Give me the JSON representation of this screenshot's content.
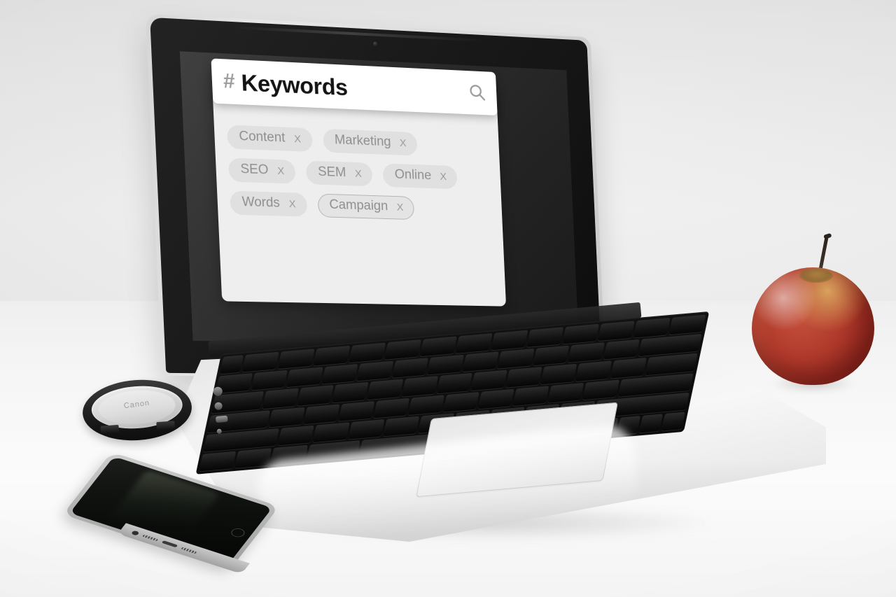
{
  "scene": {
    "title": "Keywords search app on laptop screen",
    "background_color": "#ebeaea",
    "desk_color": "#f7f7f7"
  },
  "screen": {
    "bezel_color": "#141414",
    "display_color": "#2a2a2a",
    "webcam_label": "webcam"
  },
  "app": {
    "panel_color": "#eeeeee",
    "search_bar": {
      "hash_symbol": "#",
      "title": "Keywords",
      "search_icon": "search-icon",
      "background_color": "#ffffff",
      "title_color": "#141414"
    },
    "tag_color": "#e0e0e0",
    "tag_text_color": "#8f8f8f",
    "remove_symbol": "X",
    "tag_rows": [
      [
        {
          "label": "Content",
          "remove": "X",
          "outlined": false
        },
        {
          "label": "Marketing",
          "remove": "X",
          "outlined": false
        }
      ],
      [
        {
          "label": "SEO",
          "remove": "X",
          "outlined": false
        },
        {
          "label": "SEM",
          "remove": "X",
          "outlined": false
        },
        {
          "label": "Online",
          "remove": "X",
          "outlined": false
        }
      ],
      [
        {
          "label": "Words",
          "remove": "X",
          "outlined": false
        },
        {
          "label": "Campaign",
          "remove": "X",
          "outlined": true
        }
      ]
    ]
  },
  "objects": {
    "laptop": {
      "name": "laptop",
      "body_color": "#e8e8e8",
      "keyboard_color": "#0d0d0d"
    },
    "apple": {
      "name": "red-apple",
      "color": "#b03a2c",
      "stem_color": "#2a221c"
    },
    "lens_cap": {
      "name": "camera-lens-cap",
      "brand_text": "Canon",
      "ring_color": "#1d1d1d",
      "face_color": "#d7d7d7"
    },
    "phone": {
      "name": "smartphone",
      "body_color": "#b8b8b8",
      "screen_color": "#0a0d0a"
    }
  }
}
